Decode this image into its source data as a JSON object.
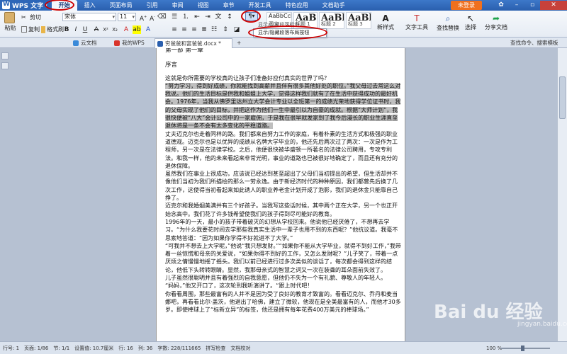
{
  "app": {
    "name": "WPS 文字",
    "login": "未登录"
  },
  "menu": [
    "开始",
    "插入",
    "页面布局",
    "引用",
    "审阅",
    "视图",
    "章节",
    "开发工具",
    "特色应用",
    "文档助手"
  ],
  "ribbon": {
    "paste": "粘贴",
    "cut": "剪切",
    "copy": "复制",
    "format_painter": "格式刷",
    "font_name": "宋体",
    "font_size": "11",
    "style_caps": [
      "正文",
      "标题 1",
      "标题 2",
      "标题 3"
    ],
    "style_samples": [
      "AaBbCcDd",
      "AaB",
      "AaBb",
      "AaBb"
    ],
    "new_style": "新样式",
    "text_tools": "文字工具",
    "find_replace": "查找替换",
    "select": "选择",
    "share": "分享文档",
    "para_tooltip_top": "显示/隐藏段落标记",
    "para_tooltip": "显示/隐藏段落布局按钮"
  },
  "tabs": [
    "云文档",
    "我的WPS",
    "穷爸爸和富爸爸.docx *"
  ],
  "quick_search": "查找命令、搜索模板",
  "document": {
    "chapter": "第一部 第一章",
    "preface": "序言",
    "question": "这就是你所需要的学校真的让孩子们准备好应付真实的世界了吗？",
    "para_hl": "“努力学习，得到好成绩，你就能找到高薪并且伴有很多其他好处的职位。”我父母过去常这么对我说。他们的生活目标是供我和姐姐上大学，觉得这样我们就有了在生活中获得成功的最好机会。1976年，当我从佛罗里达州立大学会计专业以全班第一的成绩光荣地获得学位证书时，我的父母实现了他们的目标，并把这作为他们一生中最引以为自豪的成就。根据“大师计划”，我很快便被“八大”会计公司中的一家雇佣，于是我在很早就发家到了我今后漫长的职业生涯直至退休将是一条不会有太多变化的平稳道路。",
    "para2": "丈夫迈克尔也走着同样的路。我们都来自努力工作的家庭，有着朴素的生活方式和极强的职业道德观。迈克尔也是以优异的成绩从名牌大学毕业的，他还先后两次过了两次：一次是作为工程师，另一次是在法律学校。之后，他便很快被华盛顿一所著名的法律公司聘用，专攻专利法。和我一样，他的未来看起来非常光明，事业的道路也已被很好地确定了，而且还有充分的退休保障。",
    "para3": "虽然我们在事业上很成功，应该说已经达到甚至超出了父母们当初提出的希望，但生活却并不像他们当初为我们所描绘的那么一劳永逸。由于新经济时代的种种原因，我们都曾先后换了几次工作，这使得当初看起来如此诱人的职业养老金计划开成了泡影，我们的退休金只能靠自己挣了。",
    "para4": "迈克尔和我婚姻美满并有三个好孩子。当我写这些话时候，其中两个正在大学，另一个也正开始念高中。我们花了许多钱希望使我们的孩子得到尽可能好的教育。",
    "para5": "1996年的一天，最小的孩子带着破灭的幻想从学校回来。他说他已经厌倦了，不想再去学习。“为什么我要花时间去学那些我真实生活中一辈子也用不到的东西呢？”他抗议道。我毫不思索地答道：“因为如果你学得不好就进不了大学。”",
    "para6": "“可我并不想去上大学呢，”他说“我只想发财。”“如果你不能从大学毕业，就得不到好工作，”我带着一丝惊慌和母亲的关爱说，“如果你得不到好的工作，又怎么发财呢？”儿子笑了，带着一点厌烦之情慢慢地摇了摇头。我们以前已经进行过多次类似的谈话了，每次都会得到这样的结论，他低下头转转眼睛。显然，我那母亲式的智慧之词又一次在装聋的耳朵面前失效了。",
    "para7": "儿子虽然很聪明并且有着强烈的自我意愿，但他仍不失为一个有礼貌、尊敬人的年轻人。",
    "para8": "“妈妈，”他又开口了，这次轮到我听演讲了。“跟上时代吧！",
    "para9": "你看看周围，那些最富有的人并不是因为受了良好的教育才致富的。看看迈克尔、乔丹和麦当娜吧，再看看比尔·盖茨，他退出了哈佛，建立了微软，他现在是全美最富有的人，而他才30多岁。即使棒球上了“标新立异”的标签，他还是拥有每年花费400万美元的棒球场。”"
  },
  "status": {
    "row": "行号: 1",
    "page": "页面: 1/86",
    "section": "节: 1/1",
    "pos": "设置值: 10.7厘米",
    "line": "行: 16",
    "col": "列: 36",
    "words": "字数: 228/111665",
    "spell": "拼写检查",
    "doc_check": "文档校对",
    "zoom": "100 %"
  },
  "watermark": {
    "main": "Bai du 经验",
    "sub": "jingyan.baidu.com"
  }
}
